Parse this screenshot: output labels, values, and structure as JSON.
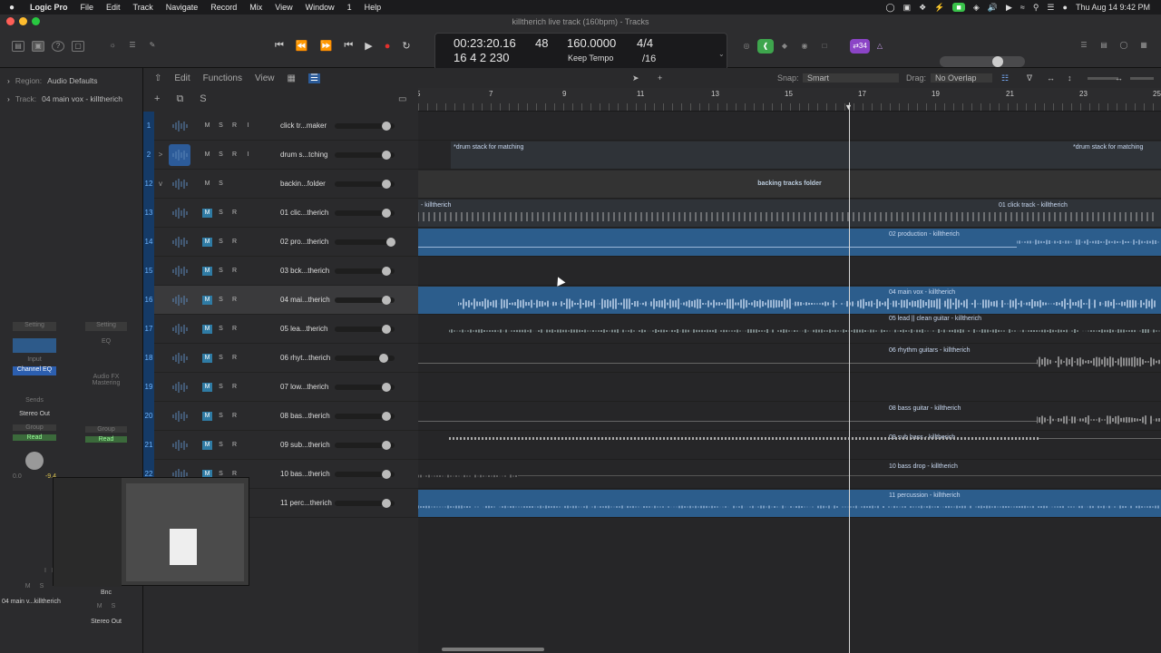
{
  "menubar": {
    "app": "Logic Pro",
    "items": [
      "File",
      "Edit",
      "Track",
      "Navigate",
      "Record",
      "Mix",
      "View",
      "Window",
      "1",
      "Help"
    ],
    "clock": "Thu Aug 14  9:42 PM"
  },
  "window": {
    "title": "killtherich live track (160bpm) - Tracks"
  },
  "lcd": {
    "time": "00:23:20.16",
    "bars": "16  4  2  230",
    "bar_field": "48",
    "tempo": "160.0000",
    "tempo_mode": "Keep Tempo",
    "sig_top": "4/4",
    "sig_bottom": "/16"
  },
  "toolbar": {
    "count_badge": "⇄34"
  },
  "inspector": {
    "region_label": "Region:",
    "region_value": "Audio Defaults",
    "track_label": "Track:",
    "track_value": "04 main vox - killtherich",
    "strip1": {
      "setting": "Setting",
      "input": "Input",
      "plugin": "Channel EQ",
      "sends": "Sends",
      "out": "Stereo Out",
      "group": "Group",
      "auto": "Read",
      "pan": "0.0",
      "level": "-9.4",
      "m": "M",
      "s": "S",
      "name": "04 main v...killtherich",
      "i": "I",
      "r": "R"
    },
    "strip2": {
      "setting": "Setting",
      "eq": "EQ",
      "fx1": "Audio FX",
      "fx2": "Mastering",
      "group": "Group",
      "auto": "Read",
      "bnc": "Bnc",
      "m": "M",
      "s": "S",
      "name": "Stereo Out"
    }
  },
  "trackheader": {
    "edit": "Edit",
    "functions": "Functions",
    "view": "View"
  },
  "arrange": {
    "snap_label": "Snap:",
    "snap_value": "Smart",
    "drag_label": "Drag:",
    "drag_value": "No Overlap",
    "ruler": [
      "5",
      "7",
      "9",
      "11",
      "13",
      "15",
      "17",
      "19",
      "21",
      "23",
      "25"
    ]
  },
  "tracks": [
    {
      "num": "1",
      "name": "click tr...maker",
      "buttons": [
        "M",
        "S",
        "R",
        "I"
      ],
      "vol": 0.9
    },
    {
      "num": "2",
      "name": "drum s...tching",
      "buttons": [
        "M",
        "S",
        "R",
        "I"
      ],
      "vol": 0.9,
      "exp": ">"
    },
    {
      "num": "12",
      "name": "backin...folder",
      "buttons": [
        "M",
        "S"
      ],
      "vol": 0.9,
      "exp": "v"
    },
    {
      "num": "13",
      "name": "01 clic...therich",
      "buttons": [
        "M",
        "S",
        "R"
      ],
      "vol": 0.9
    },
    {
      "num": "14",
      "name": "02 pro...therich",
      "buttons": [
        "M",
        "S",
        "R"
      ],
      "vol": 0.98
    },
    {
      "num": "15",
      "name": "03 bck...therich",
      "buttons": [
        "M",
        "S",
        "R"
      ],
      "vol": 0.9
    },
    {
      "num": "16",
      "name": "04 mai...therich",
      "buttons": [
        "M",
        "S",
        "R"
      ],
      "vol": 0.9
    },
    {
      "num": "17",
      "name": "05 lea...therich",
      "buttons": [
        "M",
        "S",
        "R"
      ],
      "vol": 0.9
    },
    {
      "num": "18",
      "name": "06 rhyt...therich",
      "buttons": [
        "M",
        "S",
        "R"
      ],
      "vol": 0.84
    },
    {
      "num": "19",
      "name": "07 low...therich",
      "buttons": [
        "M",
        "S",
        "R"
      ],
      "vol": 0.9
    },
    {
      "num": "20",
      "name": "08 bas...therich",
      "buttons": [
        "M",
        "S",
        "R"
      ],
      "vol": 0.9
    },
    {
      "num": "21",
      "name": "09 sub...therich",
      "buttons": [
        "M",
        "S",
        "R"
      ],
      "vol": 0.9
    },
    {
      "num": "22",
      "name": "10 bas...therich",
      "buttons": [
        "M",
        "S",
        "R"
      ],
      "vol": 0.9
    },
    {
      "num": "23",
      "name": "11 perc...therich",
      "buttons": [
        "M",
        "S",
        "R"
      ],
      "vol": 0.9
    }
  ],
  "regions": {
    "drum1": "*drum stack for matching",
    "drum2": "*drum stack for matching",
    "folder": "backing tracks folder",
    "click1": "- killtherich",
    "click2": "01 click track - killtherich",
    "prod": "02 production - killtherich",
    "vox": "04 main vox - killtherich",
    "lead": "05 lead || clean guitar - killtherich",
    "rhythm": "06 rhythm guitars - killtherich",
    "bass": "08 bass guitar - killtherich",
    "sub": "09 sub bass - killtherich",
    "drop": "10 bass drop - killtherich",
    "perc": "11 percussion - killtherich"
  }
}
